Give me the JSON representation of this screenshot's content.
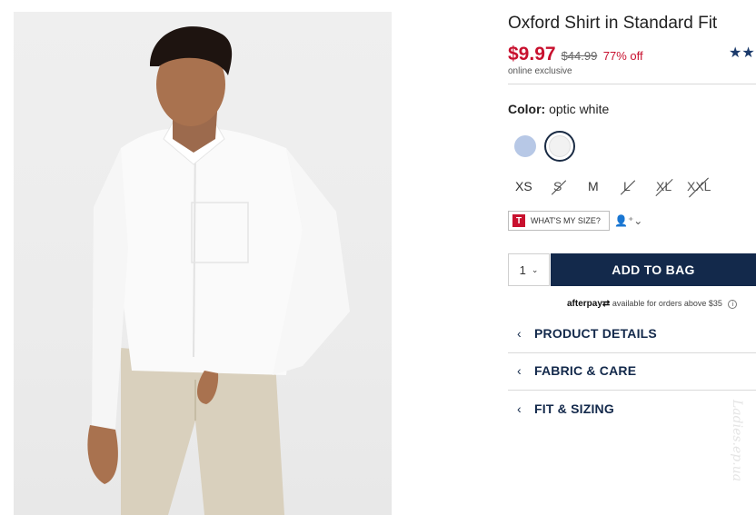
{
  "product": {
    "title": "Oxford Shirt in Standard Fit",
    "rating_stars": "★★",
    "price": "$9.97",
    "old_price": "$44.99",
    "discount": "77% off",
    "online_exclusive": "online exclusive"
  },
  "color": {
    "label": "Color:",
    "value": "optic white",
    "swatches": [
      {
        "name": "light blue",
        "hex": "#b7c8e6",
        "selected": false
      },
      {
        "name": "optic white",
        "hex": "#f2f2f2",
        "selected": true
      }
    ]
  },
  "sizes": [
    {
      "label": "XS",
      "available": true
    },
    {
      "label": "S",
      "available": false
    },
    {
      "label": "M",
      "available": true
    },
    {
      "label": "L",
      "available": false
    },
    {
      "label": "XL",
      "available": false
    },
    {
      "label": "XXL",
      "available": false
    }
  ],
  "size_help": {
    "logo": "T",
    "label": "WHAT'S MY SIZE?",
    "profile_icon": "👤⁺⌄"
  },
  "cart": {
    "quantity": "1",
    "caret": "⌄",
    "add_label": "ADD TO BAG"
  },
  "afterpay": {
    "logo": "afterpay⇄",
    "text": "available for orders above $35",
    "info": "i"
  },
  "accordions": [
    {
      "label": "PRODUCT DETAILS",
      "chevron": "‹"
    },
    {
      "label": "FABRIC & CARE",
      "chevron": "‹"
    },
    {
      "label": "FIT & SIZING",
      "chevron": "‹"
    }
  ],
  "watermark": "Ladies.ep.ua",
  "colors": {
    "brand_navy": "#13294b",
    "sale_red": "#c8102e"
  }
}
